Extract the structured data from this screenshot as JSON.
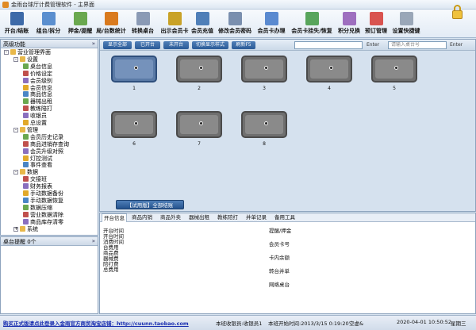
{
  "window": {
    "title": "金雨台球厅计费管理软件 - 主界面"
  },
  "toolbar": {
    "buttons": [
      {
        "label": "开台/结账",
        "icon": "monitor-icon",
        "color": "#3d6aa8"
      },
      {
        "label": "组台/拆分",
        "icon": "grid-icon",
        "color": "#5b8fcf"
      },
      {
        "label": "押金/提醒",
        "icon": "bell-icon",
        "color": "#6aa84f"
      },
      {
        "label": "局/台数统计",
        "icon": "bar-chart-icon",
        "color": "#d97a1e"
      },
      {
        "label": "转换桌台",
        "icon": "swap-icon",
        "color": "#8a9ab5"
      },
      {
        "label": "出示会员卡",
        "icon": "card-icon",
        "color": "#c9a227"
      },
      {
        "label": "会员充值",
        "icon": "user-plus-icon",
        "color": "#4f7fb8"
      },
      {
        "label": "修改会员密码",
        "icon": "key-icon",
        "color": "#7a8fae"
      },
      {
        "label": "会员卡办理",
        "icon": "card-add-icon",
        "color": "#5a8ad0"
      },
      {
        "label": "会员卡挂失/恢复",
        "icon": "card-play-icon",
        "color": "#58a55c"
      },
      {
        "label": "积分兑换",
        "icon": "gift-icon",
        "color": "#9e6fbf"
      },
      {
        "label": "预订管理",
        "icon": "clock-icon",
        "color": "#d9534f"
      },
      {
        "label": "设置快捷键",
        "icon": "keyboard-icon",
        "color": "#9aa7b8"
      }
    ]
  },
  "left": {
    "panel_title": "高级功能",
    "toggle": "»",
    "tree": [
      {
        "label": "营业管理界面",
        "level": 0,
        "icon": "folder-icon",
        "toggle": "-"
      },
      {
        "label": "设置",
        "level": 1,
        "icon": "folder-icon",
        "toggle": "-"
      },
      {
        "label": "桌台信息",
        "level": 2,
        "icon": "table-icon"
      },
      {
        "label": "价格设定",
        "level": 2,
        "icon": "price-icon"
      },
      {
        "label": "会员级别",
        "level": 2,
        "icon": "member-icon"
      },
      {
        "label": "会员信息",
        "level": 2,
        "icon": "member-icon"
      },
      {
        "label": "商品信息",
        "level": 2,
        "icon": "goods-icon"
      },
      {
        "label": "器械出租",
        "level": 2,
        "icon": "cue-icon"
      },
      {
        "label": "教练陪打",
        "level": 2,
        "icon": "coach-icon"
      },
      {
        "label": "收银员",
        "level": 2,
        "icon": "cashier-icon"
      },
      {
        "label": "总设置",
        "level": 2,
        "icon": "settings-icon"
      },
      {
        "label": "管理",
        "level": 1,
        "icon": "folder-icon",
        "toggle": "-"
      },
      {
        "label": "会员历史记录",
        "level": 2,
        "icon": "history-icon"
      },
      {
        "label": "商品进销存查询",
        "level": 2,
        "icon": "query-icon"
      },
      {
        "label": "会员升级对照",
        "level": 2,
        "icon": "upgrade-icon"
      },
      {
        "label": "灯控测试",
        "level": 2,
        "icon": "light-icon"
      },
      {
        "label": "事件查看",
        "level": 2,
        "icon": "event-icon"
      },
      {
        "label": "数据",
        "level": 1,
        "icon": "folder-icon",
        "toggle": "-"
      },
      {
        "label": "交接班",
        "level": 2,
        "icon": "shift-icon"
      },
      {
        "label": "财务报表",
        "level": 2,
        "icon": "report-icon"
      },
      {
        "label": "手动数据备份",
        "level": 2,
        "icon": "backup-icon"
      },
      {
        "label": "手动数据恢复",
        "level": 2,
        "icon": "restore-icon"
      },
      {
        "label": "数据压缩",
        "level": 2,
        "icon": "compress-icon"
      },
      {
        "label": "营业数据清除",
        "level": 2,
        "icon": "clear-icon"
      },
      {
        "label": "商品库存清零",
        "level": 2,
        "icon": "zero-icon"
      },
      {
        "label": "系统",
        "level": 1,
        "icon": "folder-icon",
        "toggle": "+"
      }
    ],
    "remind_title": "桌台提醒 0个",
    "remind_toggle": "»"
  },
  "filter": {
    "buttons": [
      "显示全部",
      "已开台",
      "未开台",
      "切换显示样式",
      "刷新F5"
    ],
    "input1_value": "",
    "enter1": "Enter",
    "input2_placeholder": "请输入桌台号",
    "enter2": "Enter"
  },
  "tables": [
    {
      "number": "1",
      "selected": true
    },
    {
      "number": "2",
      "selected": false
    },
    {
      "number": "3",
      "selected": false
    },
    {
      "number": "4",
      "selected": false
    },
    {
      "number": "5",
      "selected": false
    },
    {
      "number": "6",
      "selected": false
    },
    {
      "number": "7",
      "selected": false
    },
    {
      "number": "8",
      "selected": false
    }
  ],
  "main": {
    "big_button": "【试用版】全部结账"
  },
  "bottom": {
    "tabs": [
      "开台信息",
      "商品内销",
      "商品外卖",
      "器械出租",
      "教练陪打",
      "并单记录",
      "备用工具"
    ],
    "left_labels": [
      "开台时间",
      "开台时间",
      "消费时间",
      "台费用",
      "商品费",
      "器械费",
      "陪打费",
      "总费用"
    ],
    "mid_labels": [
      "提醒/押金",
      "会员卡号",
      "卡内余额",
      "转台并单",
      "网络桌台"
    ]
  },
  "status": {
    "link": "购买正式版请点此登录入金雨官方商贸淘宝店铺：http://cuunn.taobao.com",
    "cashier": "本班收银员:收银员1",
    "start_time": "本班开始时间:2013/3/15 0:19:20",
    "net": "空虚&",
    "datetime": "2020-04-01 10:50:52",
    "mode": "星期三"
  },
  "watermark": "LITBUG.COM"
}
